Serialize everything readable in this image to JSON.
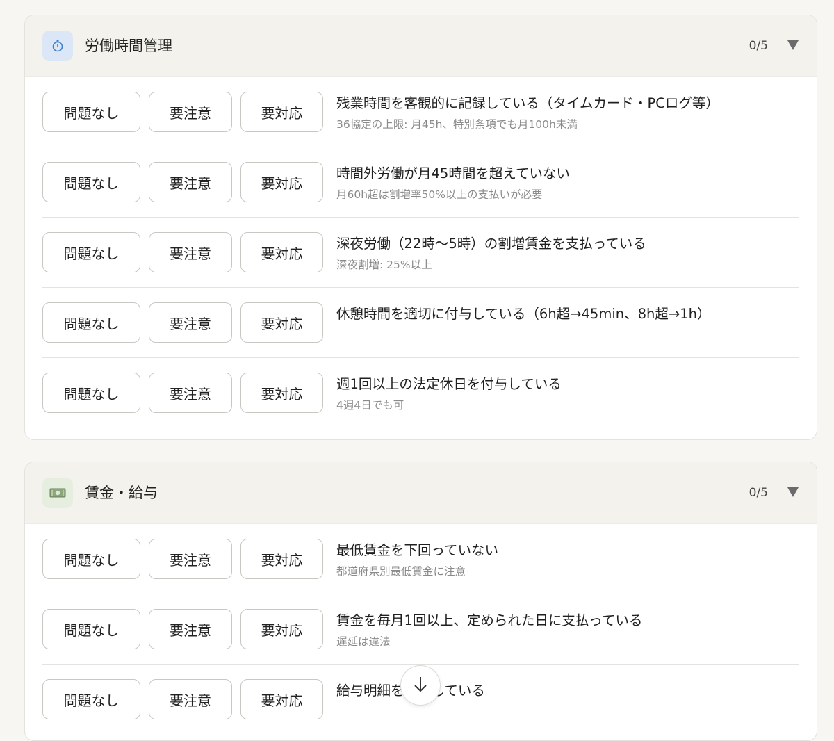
{
  "sections": [
    {
      "title": "労働時間管理",
      "count": "0/5",
      "icon": "stopwatch-icon",
      "icon_bg": "#dbe7f6",
      "items": [
        {
          "title": "残業時間を客観的に記録している（タイムカード・PCログ等）",
          "note": "36協定の上限: 月45h、特別条項でも月100h未満"
        },
        {
          "title": "時間外労働が月45時間を超えていない",
          "note": "月60h超は割増率50%以上の支払いが必要"
        },
        {
          "title": "深夜労働（22時〜5時）の割増賃金を支払っている",
          "note": "深夜割増: 25%以上"
        },
        {
          "title": "休憩時間を適切に付与している（6h超→45min、8h超→1h）",
          "note": ""
        },
        {
          "title": "週1回以上の法定休日を付与している",
          "note": "4週4日でも可"
        }
      ]
    },
    {
      "title": "賃金・給与",
      "count": "0/5",
      "icon": "money-icon",
      "icon_bg": "#e6efdf",
      "items": [
        {
          "title": "最低賃金を下回っていない",
          "note": "都道府県別最低賃金に注意"
        },
        {
          "title": "賃金を毎月1回以上、定められた日に支払っている",
          "note": "遅延は違法"
        },
        {
          "title": "給与明細を　　している",
          "note": ""
        }
      ]
    }
  ],
  "buttons": {
    "ok": "問題なし",
    "warn": "要注意",
    "act": "要対応"
  },
  "scroll_icon": "arrow-down-icon"
}
